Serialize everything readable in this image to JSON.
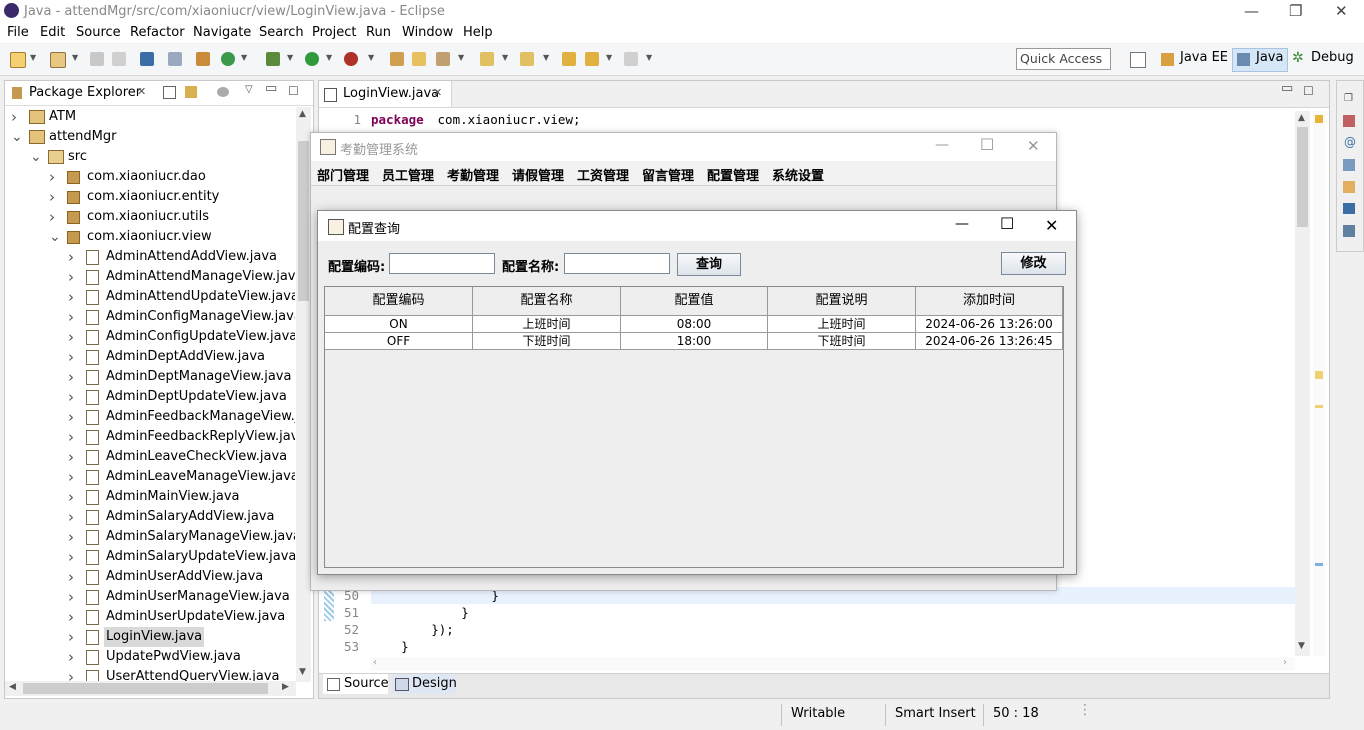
{
  "window": {
    "title": "Java - attendMgr/src/com/xiaoniucr/view/LoginView.java - Eclipse"
  },
  "menu": [
    "File",
    "Edit",
    "Source",
    "Refactor",
    "Navigate",
    "Search",
    "Project",
    "Run",
    "Window",
    "Help"
  ],
  "toolbar": {
    "quick_access": "Quick Access"
  },
  "perspectives": [
    "Java EE",
    "Java",
    "Debug"
  ],
  "package_explorer": {
    "title": "Package Explorer",
    "projects": [
      "ATM",
      "attendMgr"
    ],
    "src_label": "src",
    "packages": [
      "com.xiaoniucr.dao",
      "com.xiaoniucr.entity",
      "com.xiaoniucr.utils",
      "com.xiaoniucr.view"
    ],
    "files": [
      "AdminAttendAddView.java",
      "AdminAttendManageView.java",
      "AdminAttendUpdateView.java",
      "AdminConfigManageView.java",
      "AdminConfigUpdateView.java",
      "AdminDeptAddView.java",
      "AdminDeptManageView.java",
      "AdminDeptUpdateView.java",
      "AdminFeedbackManageView.jav",
      "AdminFeedbackReplyView.java",
      "AdminLeaveCheckView.java",
      "AdminLeaveManageView.java",
      "AdminMainView.java",
      "AdminSalaryAddView.java",
      "AdminSalaryManageView.java",
      "AdminSalaryUpdateView.java",
      "AdminUserAddView.java",
      "AdminUserManageView.java",
      "AdminUserUpdateView.java",
      "LoginView.java",
      "UpdatePwdView.java",
      "UserAttendQueryView.java"
    ]
  },
  "editor": {
    "tab": "LoginView.java",
    "line1": {
      "num": "1",
      "keyword": "package",
      "rest": " com.xiaoniucr.view;"
    },
    "bottom_lines": [
      {
        "num": "50",
        "code": "                }"
      },
      {
        "num": "51",
        "code": "            }"
      },
      {
        "num": "52",
        "code": "        });"
      },
      {
        "num": "53",
        "code": "    }"
      }
    ],
    "bottom_tabs": [
      "Source",
      "Design"
    ]
  },
  "status": {
    "writable": "Writable",
    "insert": "Smart Insert",
    "position": "50 : 18"
  },
  "app_frame": {
    "title": "考勤管理系统",
    "menu": [
      "部门管理",
      "员工管理",
      "考勤管理",
      "请假管理",
      "工资管理",
      "留言管理",
      "配置管理",
      "系统设置"
    ]
  },
  "dialog": {
    "title": "配置查询",
    "code_label": "配置编码:",
    "name_label": "配置名称:",
    "code_value": "",
    "name_value": "",
    "query_button": "查询",
    "edit_button": "修改",
    "columns": [
      "配置编码",
      "配置名称",
      "配置值",
      "配置说明",
      "添加时间"
    ],
    "rows": [
      [
        "ON",
        "上班时间",
        "08:00",
        "上班时间",
        "2024-06-26 13:26:00"
      ],
      [
        "OFF",
        "下班时间",
        "18:00",
        "下班时间",
        "2024-06-26 13:26:45"
      ]
    ]
  }
}
